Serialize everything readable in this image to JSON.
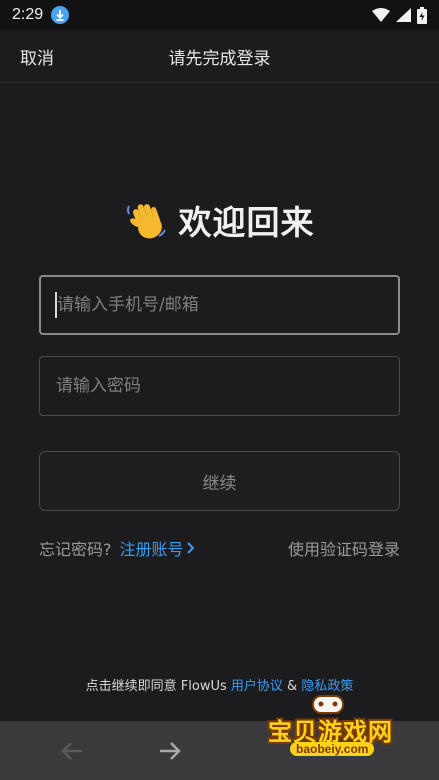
{
  "status_bar": {
    "time": "2:29"
  },
  "header": {
    "cancel_label": "取消",
    "title": "请先完成登录"
  },
  "welcome": {
    "text": "欢迎回来"
  },
  "form": {
    "account_placeholder": "请输入手机号/邮箱",
    "password_placeholder": "请输入密码",
    "continue_label": "继续"
  },
  "links": {
    "forgot_password": "忘记密码?",
    "register": "注册账号",
    "sms_login": "使用验证码登录"
  },
  "agreement": {
    "prefix": "点击继续即同意 FlowUs ",
    "user_agreement": "用户协议",
    "and": " & ",
    "privacy_policy": "隐私政策"
  },
  "watermark": {
    "title": "宝贝游戏网",
    "url": "baobeiy.com"
  },
  "colors": {
    "background": "#1c1c1e",
    "link_blue": "#3d9bf2",
    "nav_bar": "#3a3a3c"
  },
  "icons": [
    "download-icon",
    "wifi-icon",
    "signal-icon",
    "battery-icon",
    "waving-hand-icon",
    "chevron-right-icon",
    "back-arrow-icon",
    "forward-arrow-icon"
  ]
}
